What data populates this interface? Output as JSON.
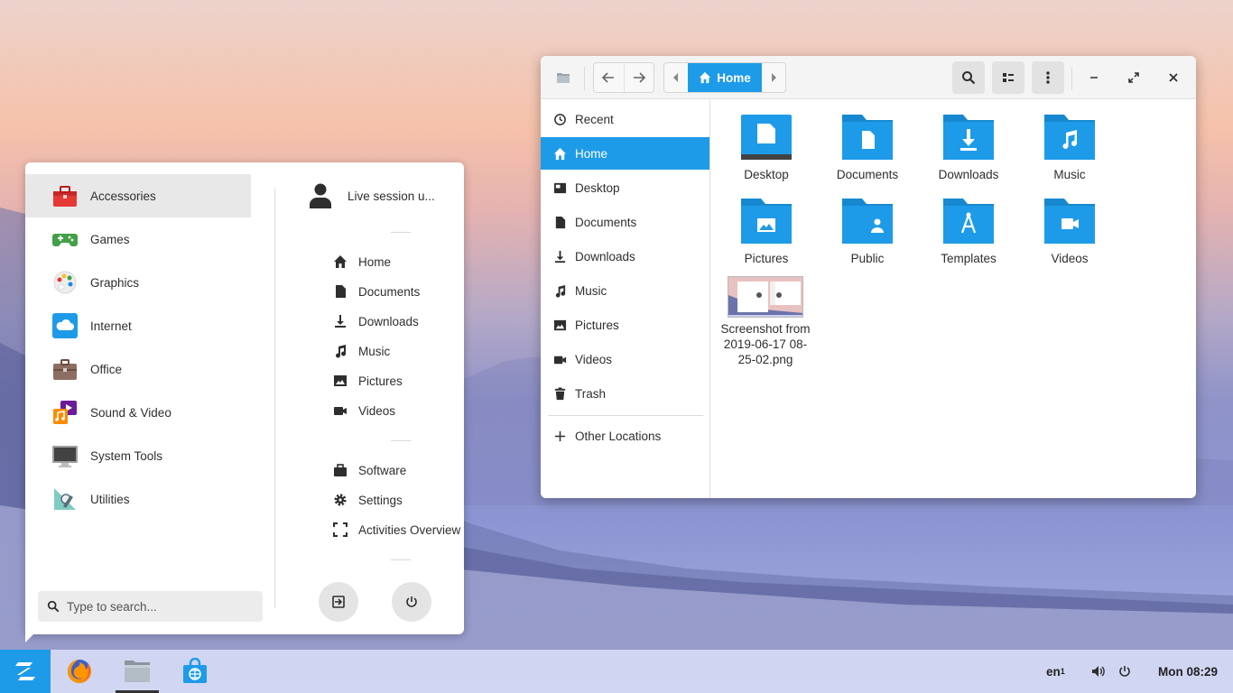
{
  "colors": {
    "accent": "#1e9be8",
    "menu_bg": "#ffffff",
    "active_row": "#e8e8e8"
  },
  "app_menu": {
    "categories": [
      {
        "label": "Accessories",
        "icon": "toolbox-icon",
        "active": true
      },
      {
        "label": "Games",
        "icon": "gamepad-icon"
      },
      {
        "label": "Graphics",
        "icon": "palette-icon"
      },
      {
        "label": "Internet",
        "icon": "cloud-icon"
      },
      {
        "label": "Office",
        "icon": "briefcase-icon"
      },
      {
        "label": "Sound & Video",
        "icon": "media-icon"
      },
      {
        "label": "System Tools",
        "icon": "monitor-icon"
      },
      {
        "label": "Utilities",
        "icon": "utilities-icon"
      }
    ],
    "user_name": "Live session u...",
    "places": [
      {
        "label": "Home",
        "icon": "home-icon"
      },
      {
        "label": "Documents",
        "icon": "document-icon"
      },
      {
        "label": "Downloads",
        "icon": "download-icon"
      },
      {
        "label": "Music",
        "icon": "music-icon"
      },
      {
        "label": "Pictures",
        "icon": "picture-icon"
      },
      {
        "label": "Videos",
        "icon": "video-icon"
      }
    ],
    "system": [
      {
        "label": "Software",
        "icon": "bag-icon"
      },
      {
        "label": "Settings",
        "icon": "gear-icon"
      },
      {
        "label": "Activities Overview",
        "icon": "overview-icon"
      }
    ],
    "search_placeholder": "Type to search..."
  },
  "file_manager": {
    "path_label": "Home",
    "sidebar": [
      {
        "label": "Recent",
        "icon": "clock-icon"
      },
      {
        "label": "Home",
        "icon": "home-icon",
        "active": true
      },
      {
        "label": "Desktop",
        "icon": "desktop-icon"
      },
      {
        "label": "Documents",
        "icon": "document-icon"
      },
      {
        "label": "Downloads",
        "icon": "download-icon"
      },
      {
        "label": "Music",
        "icon": "music-icon"
      },
      {
        "label": "Pictures",
        "icon": "picture-icon"
      },
      {
        "label": "Videos",
        "icon": "video-icon"
      },
      {
        "label": "Trash",
        "icon": "trash-icon"
      },
      {
        "label": "Other Locations",
        "icon": "plus-icon"
      }
    ],
    "files": [
      {
        "label": "Desktop",
        "icon": "desktop-folder-icon"
      },
      {
        "label": "Documents",
        "icon": "documents-folder-icon"
      },
      {
        "label": "Downloads",
        "icon": "downloads-folder-icon"
      },
      {
        "label": "Music",
        "icon": "music-folder-icon"
      },
      {
        "label": "Pictures",
        "icon": "pictures-folder-icon"
      },
      {
        "label": "Public",
        "icon": "public-folder-icon"
      },
      {
        "label": "Templates",
        "icon": "templates-folder-icon"
      },
      {
        "label": "Videos",
        "icon": "videos-folder-icon"
      },
      {
        "label": "Screenshot from 2019-06-17 08-25-02.png",
        "icon": "image-thumbnail-icon"
      }
    ]
  },
  "taskbar": {
    "apps": [
      {
        "name": "Firefox",
        "icon": "firefox-icon"
      },
      {
        "name": "Files",
        "icon": "files-icon",
        "active": true
      },
      {
        "name": "Software",
        "icon": "software-icon"
      }
    ],
    "language": "en",
    "language_suffix": "1",
    "clock": "Mon 08:29"
  }
}
